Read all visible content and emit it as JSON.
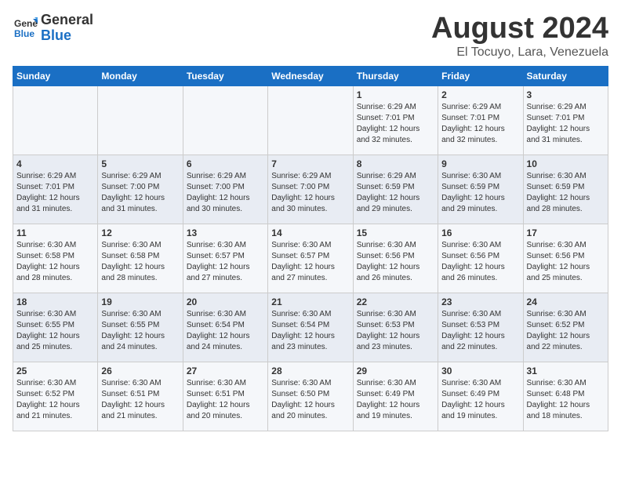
{
  "logo": {
    "line1": "General",
    "line2": "Blue"
  },
  "title": "August 2024",
  "subtitle": "El Tocuyo, Lara, Venezuela",
  "days_of_week": [
    "Sunday",
    "Monday",
    "Tuesday",
    "Wednesday",
    "Thursday",
    "Friday",
    "Saturday"
  ],
  "weeks": [
    [
      {
        "day": "",
        "info": ""
      },
      {
        "day": "",
        "info": ""
      },
      {
        "day": "",
        "info": ""
      },
      {
        "day": "",
        "info": ""
      },
      {
        "day": "1",
        "info": "Sunrise: 6:29 AM\nSunset: 7:01 PM\nDaylight: 12 hours\nand 32 minutes."
      },
      {
        "day": "2",
        "info": "Sunrise: 6:29 AM\nSunset: 7:01 PM\nDaylight: 12 hours\nand 32 minutes."
      },
      {
        "day": "3",
        "info": "Sunrise: 6:29 AM\nSunset: 7:01 PM\nDaylight: 12 hours\nand 31 minutes."
      }
    ],
    [
      {
        "day": "4",
        "info": "Sunrise: 6:29 AM\nSunset: 7:01 PM\nDaylight: 12 hours\nand 31 minutes."
      },
      {
        "day": "5",
        "info": "Sunrise: 6:29 AM\nSunset: 7:00 PM\nDaylight: 12 hours\nand 31 minutes."
      },
      {
        "day": "6",
        "info": "Sunrise: 6:29 AM\nSunset: 7:00 PM\nDaylight: 12 hours\nand 30 minutes."
      },
      {
        "day": "7",
        "info": "Sunrise: 6:29 AM\nSunset: 7:00 PM\nDaylight: 12 hours\nand 30 minutes."
      },
      {
        "day": "8",
        "info": "Sunrise: 6:29 AM\nSunset: 6:59 PM\nDaylight: 12 hours\nand 29 minutes."
      },
      {
        "day": "9",
        "info": "Sunrise: 6:30 AM\nSunset: 6:59 PM\nDaylight: 12 hours\nand 29 minutes."
      },
      {
        "day": "10",
        "info": "Sunrise: 6:30 AM\nSunset: 6:59 PM\nDaylight: 12 hours\nand 28 minutes."
      }
    ],
    [
      {
        "day": "11",
        "info": "Sunrise: 6:30 AM\nSunset: 6:58 PM\nDaylight: 12 hours\nand 28 minutes."
      },
      {
        "day": "12",
        "info": "Sunrise: 6:30 AM\nSunset: 6:58 PM\nDaylight: 12 hours\nand 28 minutes."
      },
      {
        "day": "13",
        "info": "Sunrise: 6:30 AM\nSunset: 6:57 PM\nDaylight: 12 hours\nand 27 minutes."
      },
      {
        "day": "14",
        "info": "Sunrise: 6:30 AM\nSunset: 6:57 PM\nDaylight: 12 hours\nand 27 minutes."
      },
      {
        "day": "15",
        "info": "Sunrise: 6:30 AM\nSunset: 6:56 PM\nDaylight: 12 hours\nand 26 minutes."
      },
      {
        "day": "16",
        "info": "Sunrise: 6:30 AM\nSunset: 6:56 PM\nDaylight: 12 hours\nand 26 minutes."
      },
      {
        "day": "17",
        "info": "Sunrise: 6:30 AM\nSunset: 6:56 PM\nDaylight: 12 hours\nand 25 minutes."
      }
    ],
    [
      {
        "day": "18",
        "info": "Sunrise: 6:30 AM\nSunset: 6:55 PM\nDaylight: 12 hours\nand 25 minutes."
      },
      {
        "day": "19",
        "info": "Sunrise: 6:30 AM\nSunset: 6:55 PM\nDaylight: 12 hours\nand 24 minutes."
      },
      {
        "day": "20",
        "info": "Sunrise: 6:30 AM\nSunset: 6:54 PM\nDaylight: 12 hours\nand 24 minutes."
      },
      {
        "day": "21",
        "info": "Sunrise: 6:30 AM\nSunset: 6:54 PM\nDaylight: 12 hours\nand 23 minutes."
      },
      {
        "day": "22",
        "info": "Sunrise: 6:30 AM\nSunset: 6:53 PM\nDaylight: 12 hours\nand 23 minutes."
      },
      {
        "day": "23",
        "info": "Sunrise: 6:30 AM\nSunset: 6:53 PM\nDaylight: 12 hours\nand 22 minutes."
      },
      {
        "day": "24",
        "info": "Sunrise: 6:30 AM\nSunset: 6:52 PM\nDaylight: 12 hours\nand 22 minutes."
      }
    ],
    [
      {
        "day": "25",
        "info": "Sunrise: 6:30 AM\nSunset: 6:52 PM\nDaylight: 12 hours\nand 21 minutes."
      },
      {
        "day": "26",
        "info": "Sunrise: 6:30 AM\nSunset: 6:51 PM\nDaylight: 12 hours\nand 21 minutes."
      },
      {
        "day": "27",
        "info": "Sunrise: 6:30 AM\nSunset: 6:51 PM\nDaylight: 12 hours\nand 20 minutes."
      },
      {
        "day": "28",
        "info": "Sunrise: 6:30 AM\nSunset: 6:50 PM\nDaylight: 12 hours\nand 20 minutes."
      },
      {
        "day": "29",
        "info": "Sunrise: 6:30 AM\nSunset: 6:49 PM\nDaylight: 12 hours\nand 19 minutes."
      },
      {
        "day": "30",
        "info": "Sunrise: 6:30 AM\nSunset: 6:49 PM\nDaylight: 12 hours\nand 19 minutes."
      },
      {
        "day": "31",
        "info": "Sunrise: 6:30 AM\nSunset: 6:48 PM\nDaylight: 12 hours\nand 18 minutes."
      }
    ]
  ]
}
